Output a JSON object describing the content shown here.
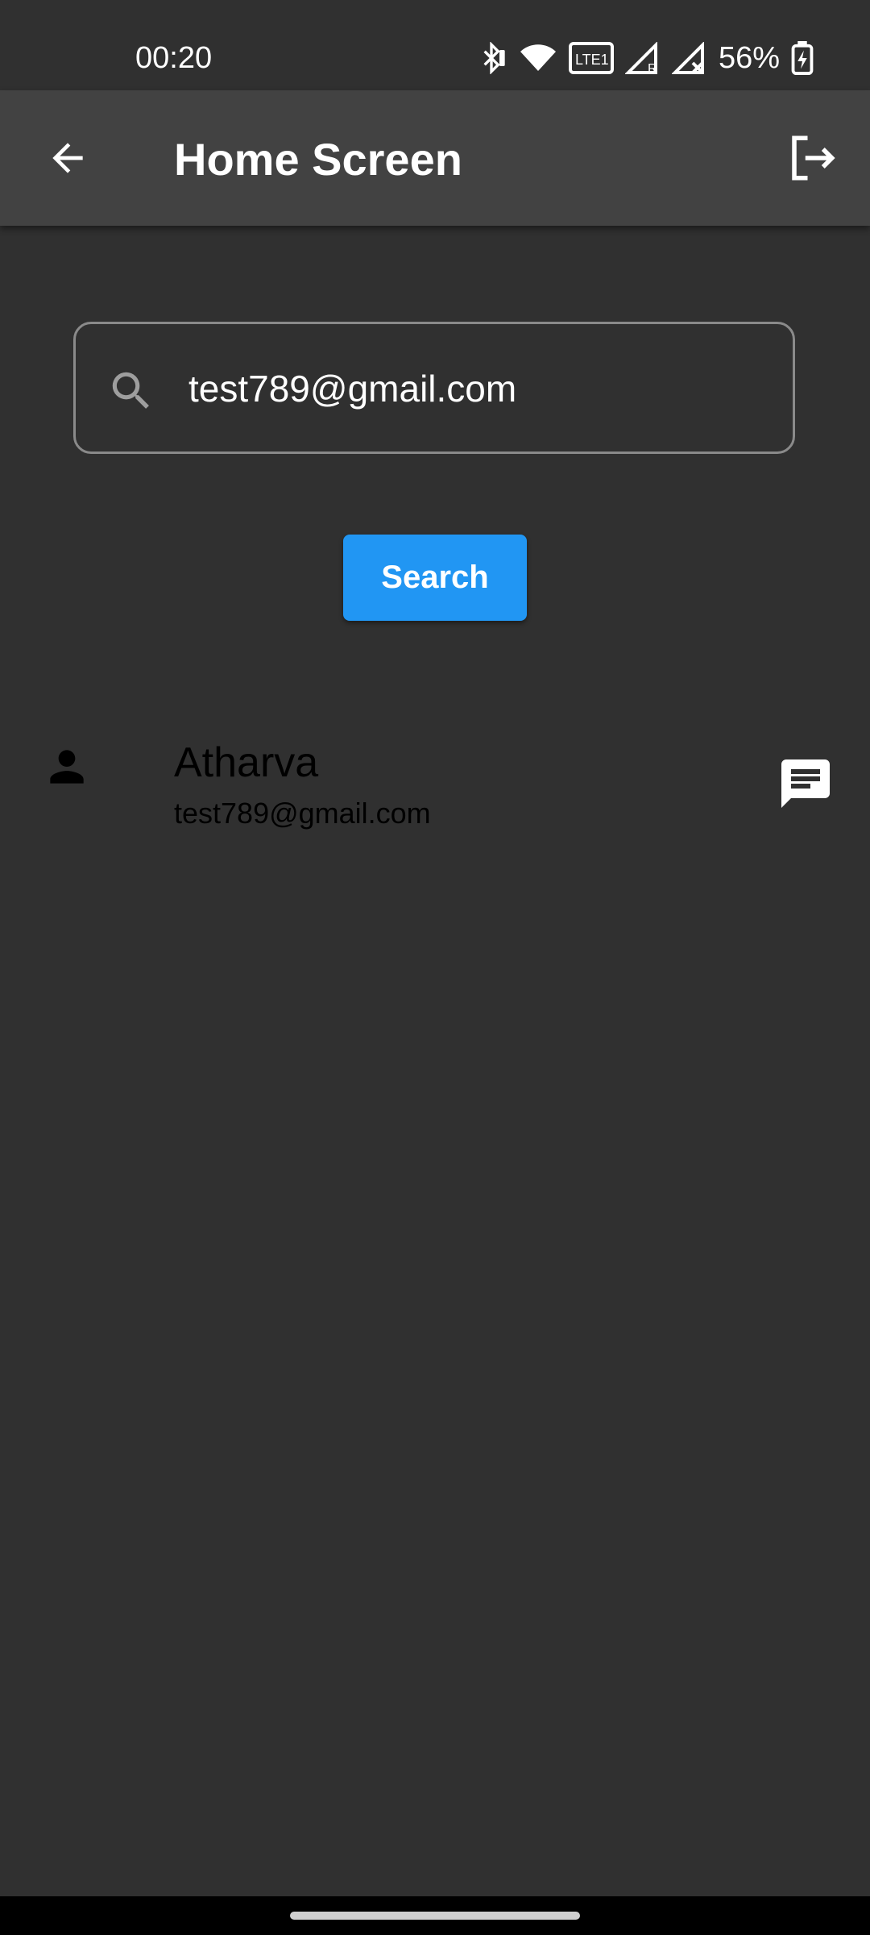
{
  "status_bar": {
    "time": "00:20",
    "battery": "56%",
    "icons": [
      "bluetooth-icon",
      "wifi-icon",
      "volte-icon",
      "signal-roaming-icon",
      "signal-no-service-icon",
      "battery-charging-icon"
    ]
  },
  "app_bar": {
    "title": "Home Screen",
    "back_icon": "arrow-back-icon",
    "logout_icon": "logout-icon"
  },
  "search": {
    "value": "test789@gmail.com",
    "icon": "search-icon",
    "button_label": "Search"
  },
  "results": [
    {
      "name": "Atharva",
      "email": "test789@gmail.com",
      "avatar_icon": "person-icon",
      "action_icon": "chat-icon"
    }
  ],
  "colors": {
    "background": "#303030",
    "app_bar": "#424242",
    "accent": "#2196f3",
    "text_primary": "#ffffff",
    "list_text": "#000000"
  }
}
